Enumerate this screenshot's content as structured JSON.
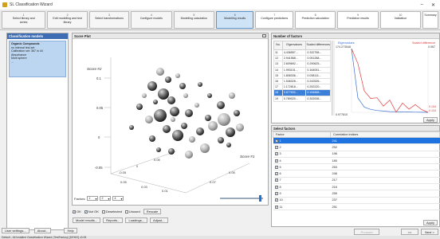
{
  "window": {
    "title": "SL Classification Wizard",
    "minimize": "–",
    "close": "✕"
  },
  "steps": [
    {
      "num": "1",
      "label": "Select library and",
      "label2": "series"
    },
    {
      "num": "2",
      "label": "Edit modelling and test",
      "label2": "library"
    },
    {
      "num": "3",
      "label": "Select transformations",
      "label2": ""
    },
    {
      "num": "4",
      "label": "Configure models",
      "label2": ""
    },
    {
      "num": "5",
      "label": "Modelling calculation",
      "label2": ""
    },
    {
      "num": "6",
      "label": "Modelling results",
      "label2": ""
    },
    {
      "num": "7",
      "label": "Configure predictions",
      "label2": ""
    },
    {
      "num": "8",
      "label": "Prediction calculation",
      "label2": ""
    },
    {
      "num": "9",
      "label": "Prediction results",
      "label2": ""
    },
    {
      "num": "10",
      "label": "Validation",
      "label2": ""
    },
    {
      "num": "",
      "label": "Summary",
      "label2": ""
    }
  ],
  "left_panel": {
    "title": "Classification models",
    "item": {
      "title": "Organic Compounds",
      "lines": [
        "no internal test set",
        "Calibration set: 367 in 44",
        "Absorbance",
        "Multi sphere",
        "..."
      ]
    }
  },
  "score_plot": {
    "title": "Score Plot",
    "axis2": "Score #2",
    "axis1": "Score #1",
    "ticks_y": [
      "0.1",
      "0.05",
      "0",
      "-0.05"
    ],
    "ticks_x": [
      "0.05",
      "0.03",
      "0.01",
      "0.07",
      "0.05"
    ],
    "ticks_z": [
      "-0.05",
      "0",
      "0.05"
    ],
    "factors_label": "Factors:",
    "factor_values": [
      "1",
      "2",
      "4"
    ]
  },
  "checkboxes": [
    {
      "label": "OK",
      "checked": true
    },
    {
      "label": "Not OK",
      "checked": true
    },
    {
      "label": "Deselected",
      "checked": false
    },
    {
      "label": "Unused",
      "checked": false
    }
  ],
  "buttons": {
    "rescale": "Rescale",
    "model_results": "Model results...",
    "reports": "Reports...",
    "loadings": "Loadings...",
    "adjust": "Adjust...",
    "user_settings": "User settings...",
    "about": "About...",
    "help": "Help",
    "apply": "Apply",
    "back": "<< Back",
    "next": "Next >",
    "proceed": "Proceed"
  },
  "number_of_factors": {
    "title": "Number of factors",
    "columns": [
      "No.",
      "Eigenvalues",
      "Scaled differences"
    ],
    "rows": [
      [
        "11",
        "4.436557...",
        "0.332758..."
      ],
      [
        "12",
        "2.941568...",
        "0.051288..."
      ],
      [
        "13",
        "2.609692...",
        "0.290625..."
      ],
      [
        "14",
        "1.993101...",
        "0.164051..."
      ],
      [
        "15",
        "1.806336...",
        "0.038111..."
      ],
      [
        "16",
        "1.546328...",
        "0.242526..."
      ],
      [
        "17",
        "1.172818...",
        "0.252220..."
      ],
      [
        "18",
        "0.877600...",
        "0.184888..."
      ],
      [
        "19",
        "0.789020...",
        "0.302006..."
      ]
    ],
    "highlight_row": 7,
    "chart_legend_left": "Eigenvalues",
    "chart_legend_right": "Scaled difference",
    "chart_top_left": "174.273548",
    "chart_top_right": "0.957",
    "chart_bottom_left": "0.977810",
    "chart_bottom_right1": "0.154",
    "chart_bottom_right2": "0.118"
  },
  "chart_data": {
    "type": "line",
    "series": [
      {
        "name": "Eigenvalues",
        "color": "#3a6fd0",
        "values": [
          174.27,
          40,
          15,
          9,
          6,
          4.4,
          2.9,
          2.6,
          2.0,
          1.8,
          1.5,
          1.2,
          0.98
        ]
      },
      {
        "name": "Scaled difference",
        "color": "#e03a3a",
        "values": [
          0.957,
          0.76,
          0.4,
          0.3,
          0.31,
          0.2,
          0.28,
          0.12,
          0.24,
          0.16,
          0.22,
          0.154,
          0.118
        ]
      }
    ]
  },
  "select_factors": {
    "title": "Select factors",
    "columns": [
      "Factor",
      "Correlation indices"
    ],
    "rows": [
      [
        "1",
        "241",
        true
      ],
      [
        "2",
        "252",
        true
      ],
      [
        "3",
        "196",
        true
      ],
      [
        "4",
        "180",
        true
      ],
      [
        "5",
        "253",
        true
      ],
      [
        "6",
        "246",
        true
      ],
      [
        "7",
        "217",
        true
      ],
      [
        "8",
        "216",
        true
      ],
      [
        "9",
        "255",
        true
      ],
      [
        "10",
        "237",
        true
      ],
      [
        "11",
        "251",
        true
      ]
    ],
    "highlight_row": 0
  },
  "status": "Default - All Installed Classification Wizard (TestFactory) [DEMO] v3.05"
}
